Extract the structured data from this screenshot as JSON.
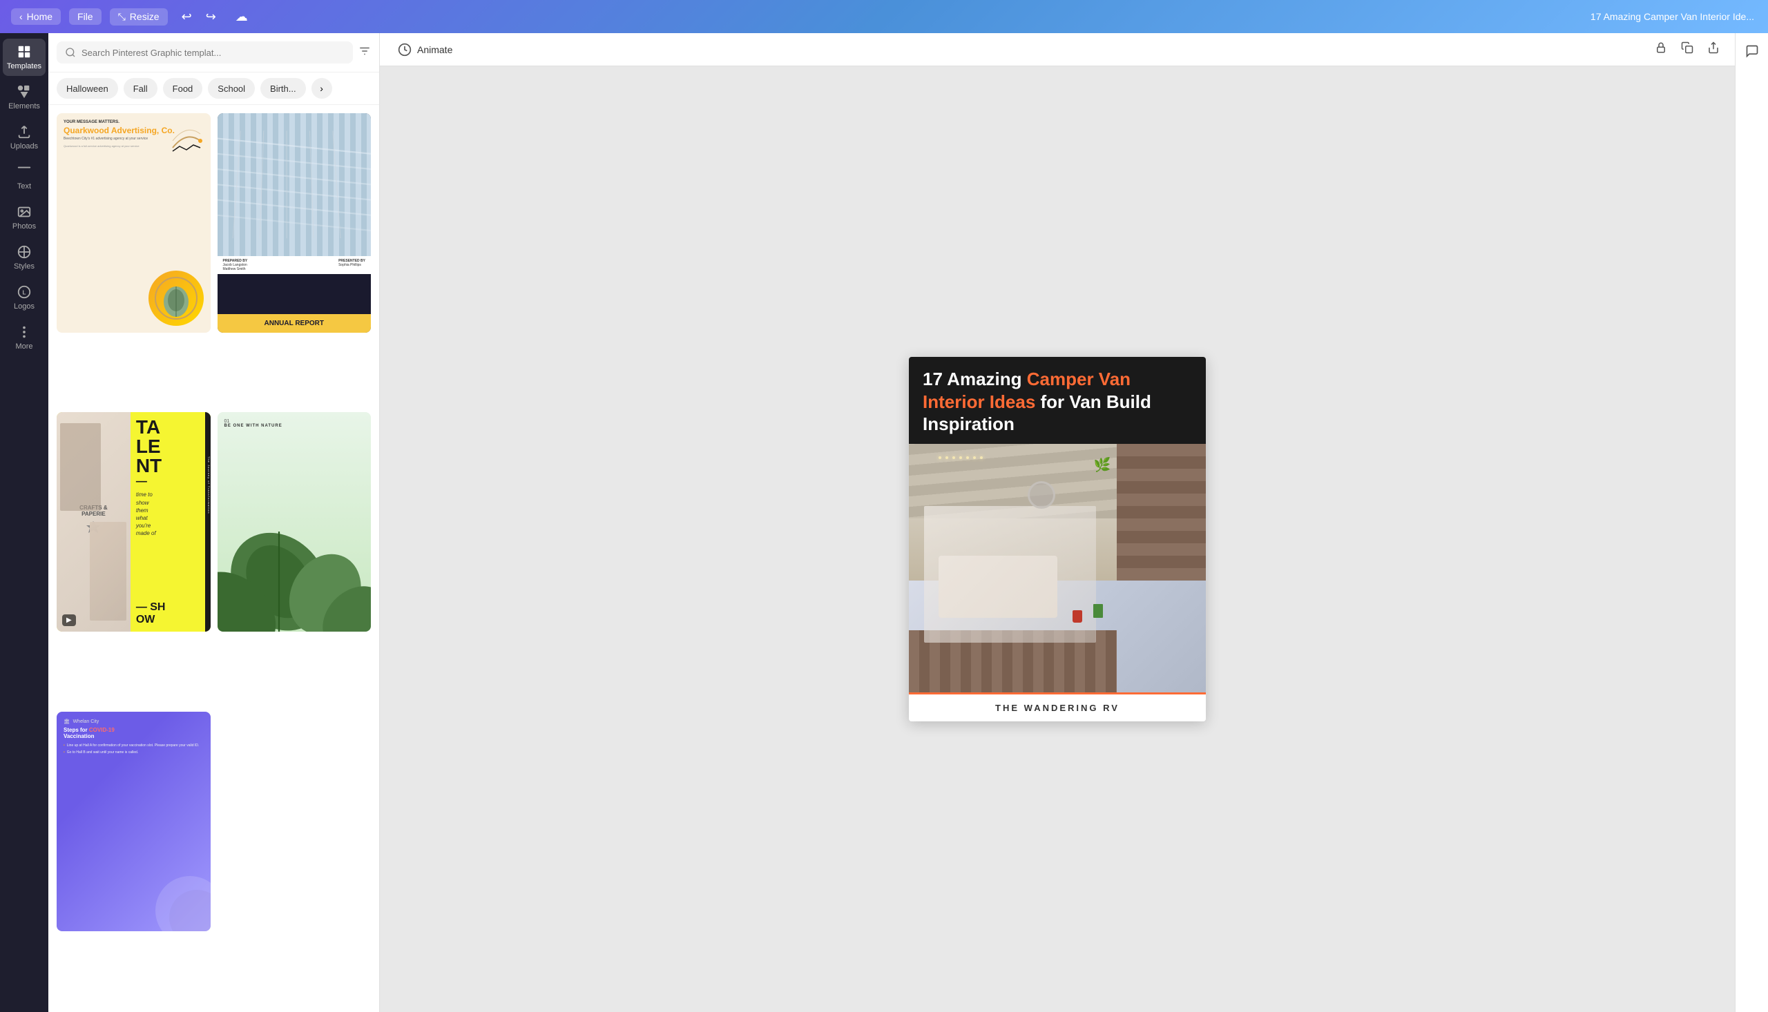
{
  "topbar": {
    "home_label": "Home",
    "file_label": "File",
    "resize_label": "Resize",
    "title": "17 Amazing Camper Van Interior Ide...",
    "undo_icon": "↩",
    "redo_icon": "↪",
    "cloud_icon": "☁"
  },
  "sidebar": {
    "items": [
      {
        "id": "templates",
        "label": "Templates",
        "icon": "grid"
      },
      {
        "id": "elements",
        "label": "Elements",
        "icon": "shapes"
      },
      {
        "id": "uploads",
        "label": "Uploads",
        "icon": "upload"
      },
      {
        "id": "text",
        "label": "Text",
        "icon": "text"
      },
      {
        "id": "photos",
        "label": "Photos",
        "icon": "photos"
      },
      {
        "id": "styles",
        "label": "Styles",
        "icon": "styles"
      },
      {
        "id": "logos",
        "label": "Logos",
        "icon": "logos"
      },
      {
        "id": "more",
        "label": "More",
        "icon": "more"
      }
    ]
  },
  "search": {
    "placeholder": "Search Pinterest Graphic templat...",
    "value": ""
  },
  "filter_chips": [
    {
      "label": "Halloween",
      "active": false
    },
    {
      "label": "Fall",
      "active": false
    },
    {
      "label": "Food",
      "active": false
    },
    {
      "label": "School",
      "active": false
    },
    {
      "label": "Birth...",
      "active": false
    }
  ],
  "templates": [
    {
      "id": 1,
      "type": "quarkwood",
      "small_text": "YOUR MESSAGE MATTERS.",
      "title": "Quarkwood Advertising, Co.",
      "body": "Beechtown City's #1 advertising agency at your service",
      "cta": "NO CONVEY YOUR DESIRES IN A SIMPLE YET POWERFUL WAY"
    },
    {
      "id": 2,
      "type": "annual_report",
      "label": "ANNUAL REPORT",
      "prepared_by": "PREPARED BY",
      "presented_by": "PRESENTED BY",
      "name1": "Jacob Langston",
      "name2": "Sophia Phillips",
      "name3": "Matthew Smith"
    },
    {
      "id": 3,
      "type": "talent",
      "lines": [
        "TA",
        "LE",
        "NT"
      ],
      "dash": "—",
      "subtext": "time to show them what you're made of",
      "show": "— SH OW",
      "has_video": true
    },
    {
      "id": 4,
      "type": "nature",
      "number": "01",
      "be_text": "BE ONE WITH NATURE"
    },
    {
      "id": 5,
      "type": "covid",
      "header": "Whelan City",
      "title": "Steps for COVID-19 Vaccination",
      "list_items": [
        "Line up at Hall A for confirmation of your vaccination slot. Please prepare your valid ID.",
        "Go to Hall B and wait until your name is called."
      ]
    }
  ],
  "canvas": {
    "animate_label": "Animate",
    "pinterest_card": {
      "title_part1": "17 Amazing ",
      "title_orange": "Camper Van Interior Ideas",
      "title_part2": " for Van Build Inspiration",
      "brand": "THE WANDERING RV"
    }
  },
  "toolbar_icons": {
    "lock": "🔒",
    "copy": "⧉",
    "share": "↑"
  }
}
